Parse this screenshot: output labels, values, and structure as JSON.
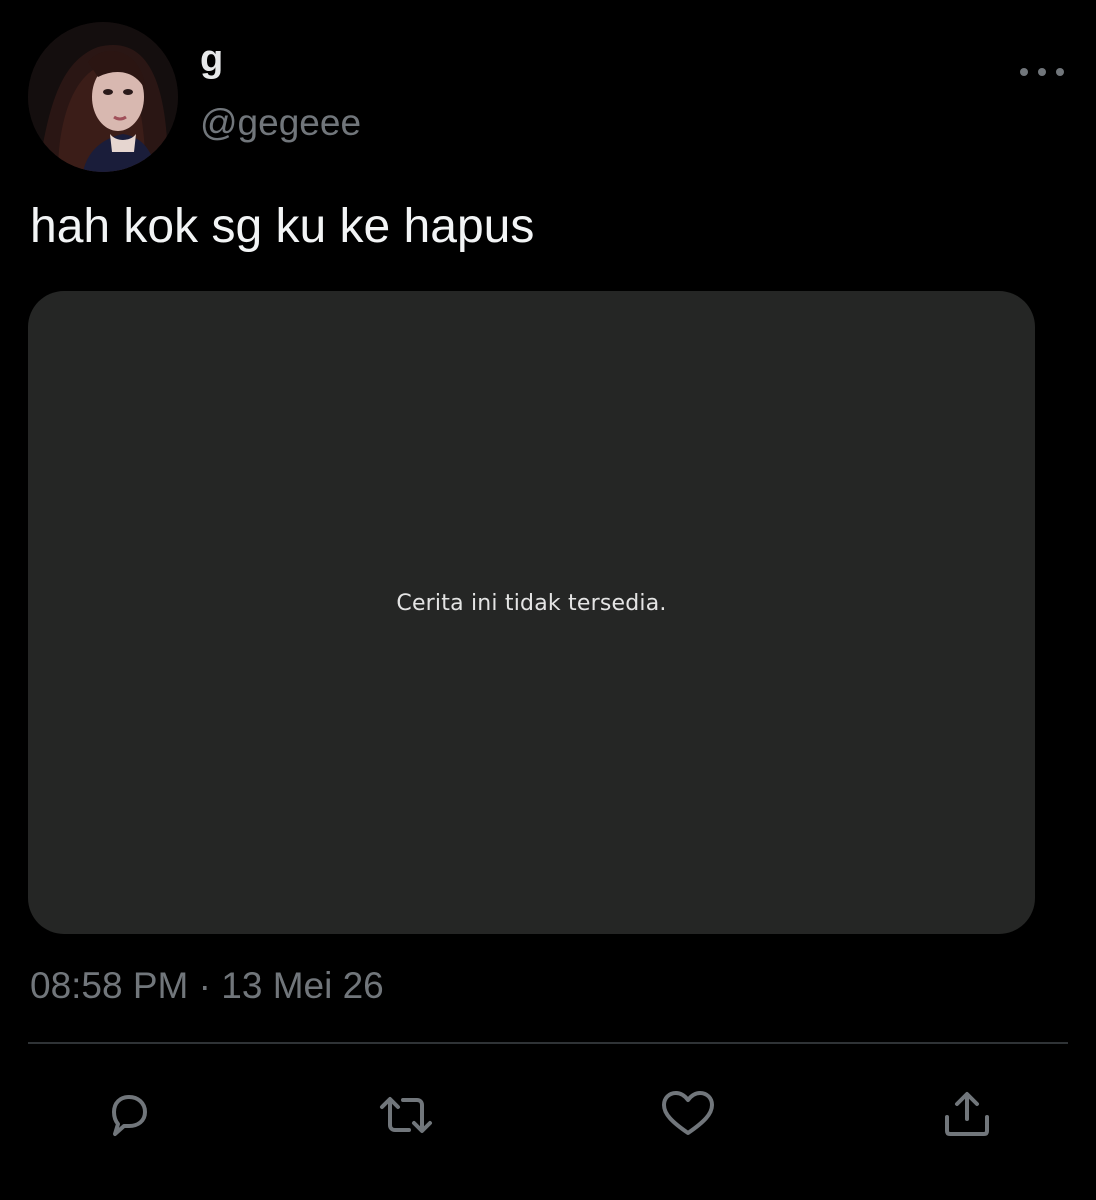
{
  "tweet": {
    "author": {
      "display_name": "g",
      "handle": "@gegeee"
    },
    "text": "hah kok sg ku ke hapus",
    "media": {
      "message": "Cerita ini tidak tersedia."
    },
    "time": "08:58 PM",
    "separator": "·",
    "date": "13 Mei 26"
  },
  "icons": {
    "more": "more-horizontal-icon",
    "reply": "reply-icon",
    "retweet": "retweet-icon",
    "like": "heart-icon",
    "share": "share-icon"
  },
  "colors": {
    "background": "#000000",
    "primary_text": "#e7e9ea",
    "secondary_text": "#71767b",
    "media_background": "#252625",
    "divider": "#2f3336"
  }
}
